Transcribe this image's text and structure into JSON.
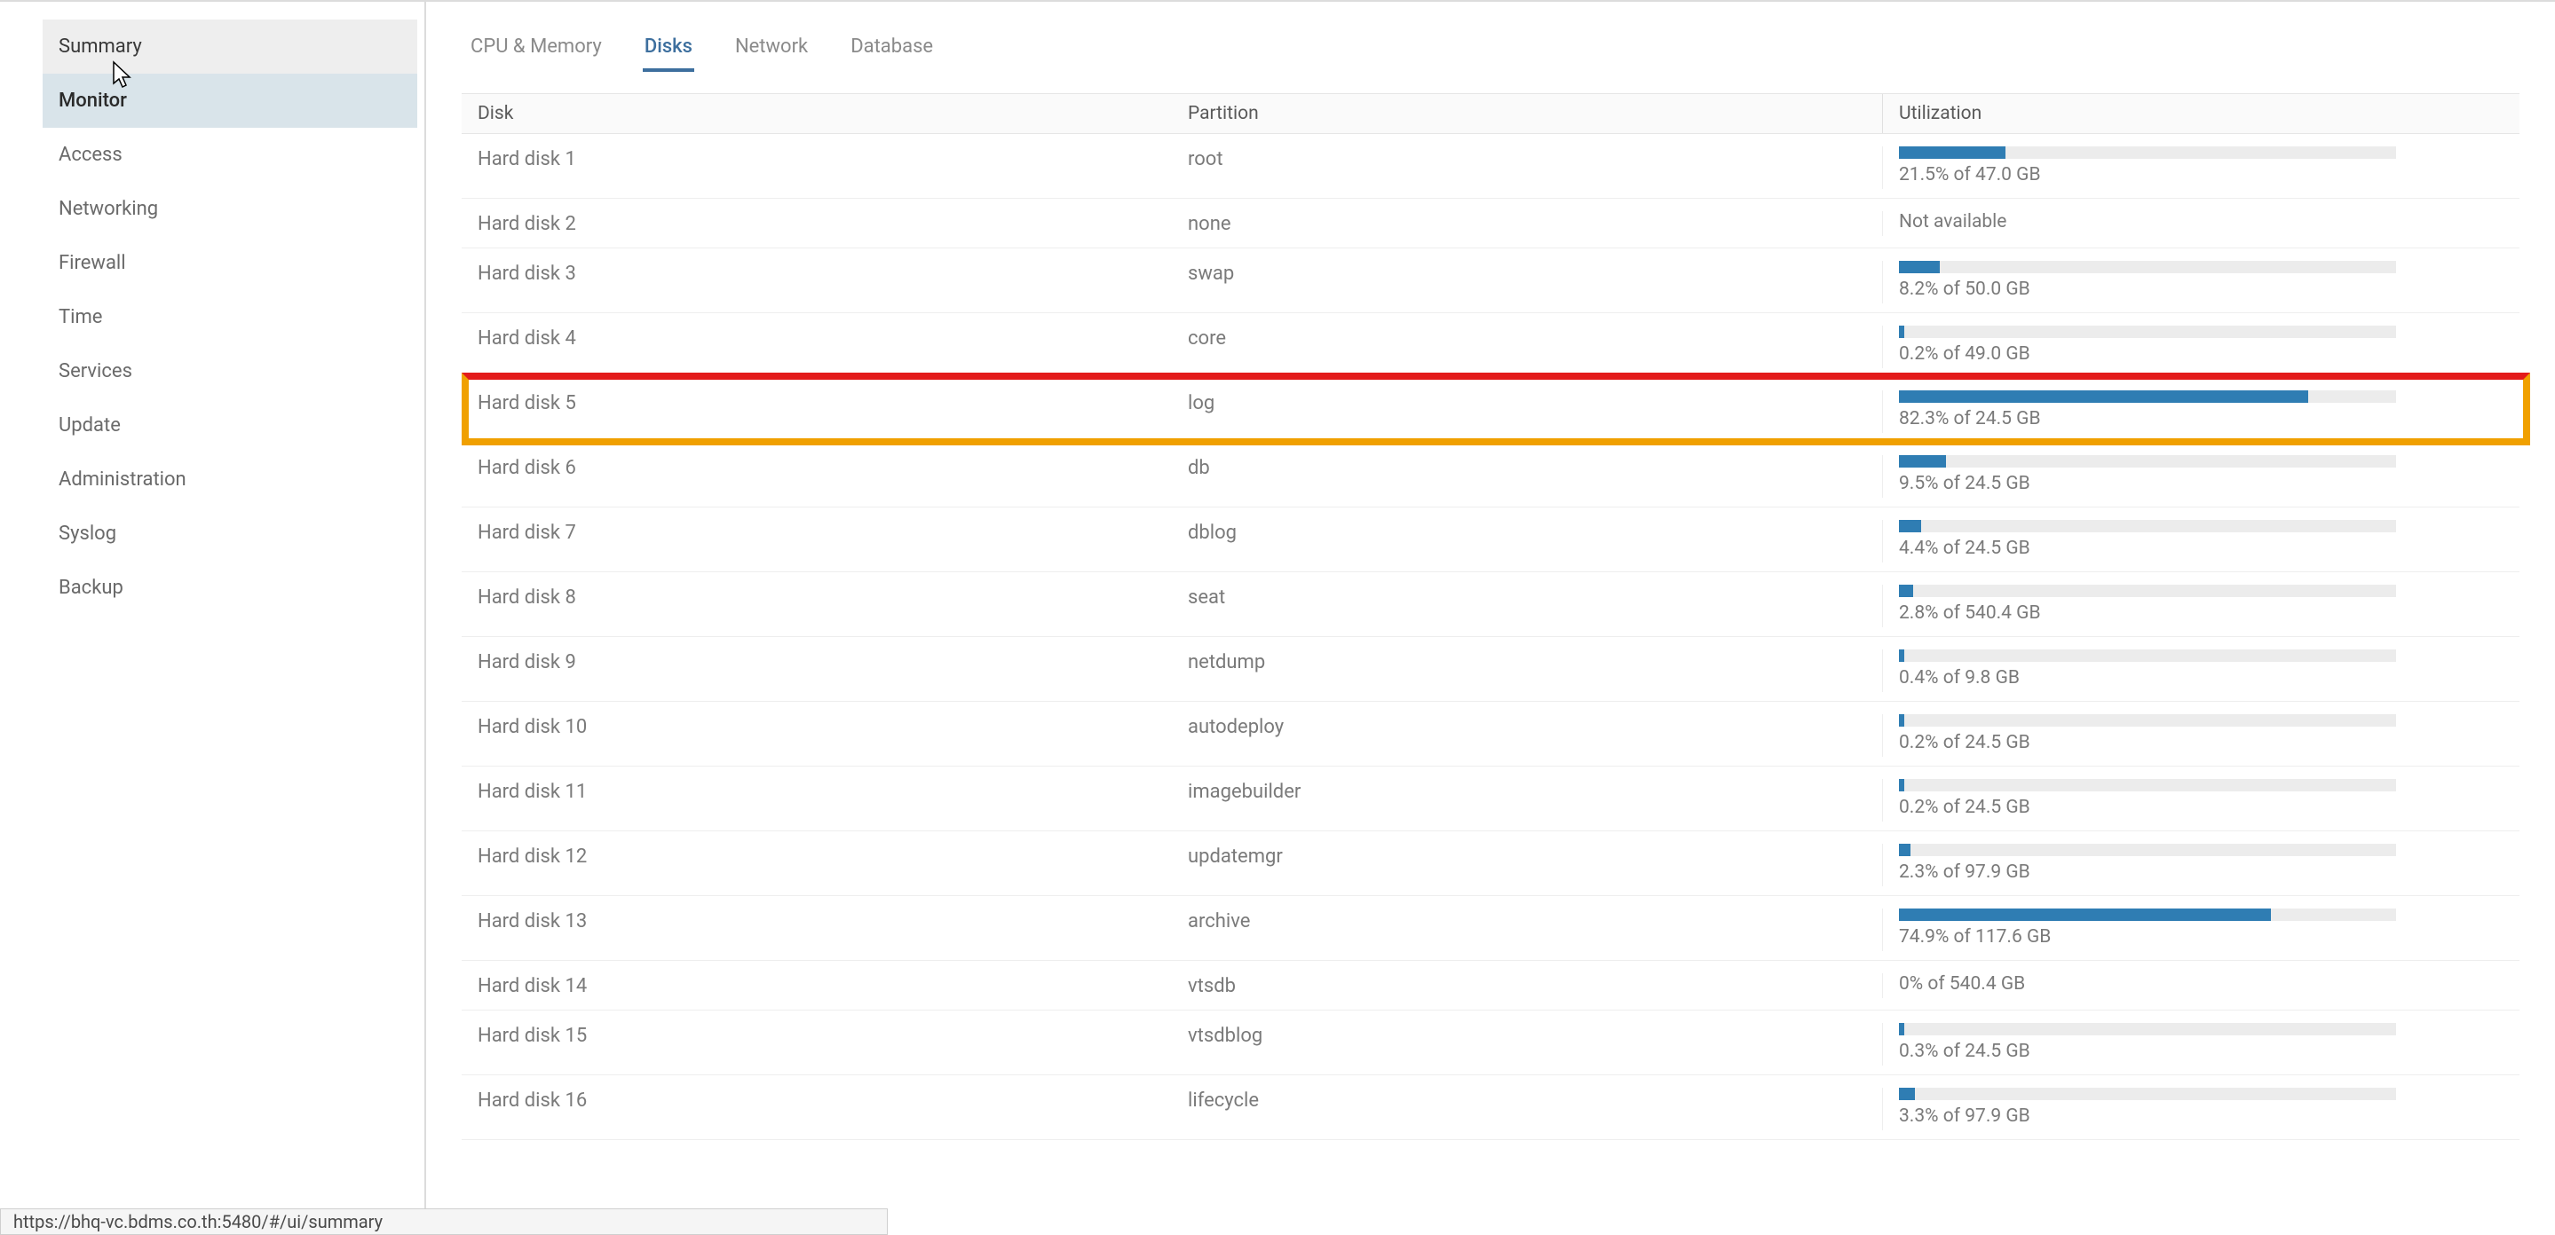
{
  "sidebar": {
    "items": [
      {
        "label": "Summary",
        "state": "hovered"
      },
      {
        "label": "Monitor",
        "state": "active"
      },
      {
        "label": "Access",
        "state": ""
      },
      {
        "label": "Networking",
        "state": ""
      },
      {
        "label": "Firewall",
        "state": ""
      },
      {
        "label": "Time",
        "state": ""
      },
      {
        "label": "Services",
        "state": ""
      },
      {
        "label": "Update",
        "state": ""
      },
      {
        "label": "Administration",
        "state": ""
      },
      {
        "label": "Syslog",
        "state": ""
      },
      {
        "label": "Backup",
        "state": ""
      }
    ]
  },
  "tabs": {
    "items": [
      {
        "label": "CPU & Memory",
        "active": false
      },
      {
        "label": "Disks",
        "active": true
      },
      {
        "label": "Network",
        "active": false
      },
      {
        "label": "Database",
        "active": false
      }
    ]
  },
  "table": {
    "headers": {
      "disk": "Disk",
      "partition": "Partition",
      "utilization": "Utilization"
    },
    "rows": [
      {
        "disk": "Hard disk 1",
        "partition": "root",
        "util_pct": 21.5,
        "util_text": "21.5% of 47.0 GB",
        "has_bar": true,
        "highlight": false
      },
      {
        "disk": "Hard disk 2",
        "partition": "none",
        "util_pct": null,
        "util_text": "Not available",
        "has_bar": false,
        "highlight": false
      },
      {
        "disk": "Hard disk 3",
        "partition": "swap",
        "util_pct": 8.2,
        "util_text": "8.2% of 50.0 GB",
        "has_bar": true,
        "highlight": false
      },
      {
        "disk": "Hard disk 4",
        "partition": "core",
        "util_pct": 0.2,
        "util_text": "0.2% of 49.0 GB",
        "has_bar": true,
        "highlight": false
      },
      {
        "disk": "Hard disk 5",
        "partition": "log",
        "util_pct": 82.3,
        "util_text": "82.3% of 24.5 GB",
        "has_bar": true,
        "highlight": true
      },
      {
        "disk": "Hard disk 6",
        "partition": "db",
        "util_pct": 9.5,
        "util_text": "9.5% of 24.5 GB",
        "has_bar": true,
        "highlight": false
      },
      {
        "disk": "Hard disk 7",
        "partition": "dblog",
        "util_pct": 4.4,
        "util_text": "4.4% of 24.5 GB",
        "has_bar": true,
        "highlight": false
      },
      {
        "disk": "Hard disk 8",
        "partition": "seat",
        "util_pct": 2.8,
        "util_text": "2.8% of 540.4 GB",
        "has_bar": true,
        "highlight": false
      },
      {
        "disk": "Hard disk 9",
        "partition": "netdump",
        "util_pct": 0.4,
        "util_text": "0.4% of 9.8 GB",
        "has_bar": true,
        "highlight": false
      },
      {
        "disk": "Hard disk 10",
        "partition": "autodeploy",
        "util_pct": 0.2,
        "util_text": "0.2% of 24.5 GB",
        "has_bar": true,
        "highlight": false
      },
      {
        "disk": "Hard disk 11",
        "partition": "imagebuilder",
        "util_pct": 0.2,
        "util_text": "0.2% of 24.5 GB",
        "has_bar": true,
        "highlight": false
      },
      {
        "disk": "Hard disk 12",
        "partition": "updatemgr",
        "util_pct": 2.3,
        "util_text": "2.3% of 97.9 GB",
        "has_bar": true,
        "highlight": false
      },
      {
        "disk": "Hard disk 13",
        "partition": "archive",
        "util_pct": 74.9,
        "util_text": "74.9% of 117.6 GB",
        "has_bar": true,
        "highlight": false
      },
      {
        "disk": "Hard disk 14",
        "partition": "vtsdb",
        "util_pct": 0.0,
        "util_text": "0% of 540.4 GB",
        "has_bar": false,
        "highlight": false
      },
      {
        "disk": "Hard disk 15",
        "partition": "vtsdblog",
        "util_pct": 0.3,
        "util_text": "0.3% of 24.5 GB",
        "has_bar": true,
        "highlight": false
      },
      {
        "disk": "Hard disk 16",
        "partition": "lifecycle",
        "util_pct": 3.3,
        "util_text": "3.3% of 97.9 GB",
        "has_bar": true,
        "highlight": false
      }
    ]
  },
  "statusbar": {
    "url": "https://bhq-vc.bdms.co.th:5480/#/ui/summary"
  }
}
